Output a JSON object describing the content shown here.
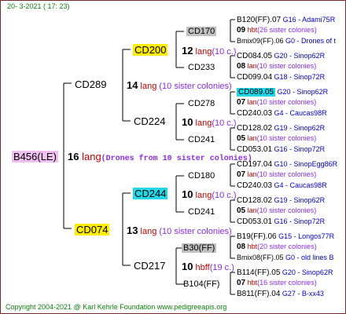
{
  "date": "20-  3-2021 ( 17: 23)",
  "footer": "Copyright 2004-2021 @ Karl Kehrle Foundation    www.pedigreeapis.org",
  "colors": {
    "yellow": "#ffee00",
    "cyan": "#22d8e8",
    "pink": "#f0c0f0",
    "gray": "#c0c0c0",
    "brand_green": "#0a7d0a",
    "lang_red": "#c00000",
    "annotation_purple": "#8a2be2",
    "info_blue": "#0000c0"
  },
  "root": {
    "name": "B456(LE)",
    "num": "16",
    "lang": "lang",
    "note": "(Drones from 10 sister colonies)"
  },
  "gen1": [
    {
      "name": "CD289",
      "num": "14",
      "lang": "lang",
      "note": "(10 sister colonies)"
    },
    {
      "name": "CD074",
      "num": "13",
      "lang": "lang",
      "note": "(10 sister colonies)"
    }
  ],
  "gen2": [
    {
      "name": "CD200",
      "num": "12",
      "lang": "lang",
      "note": "(10 c.)"
    },
    {
      "name": "CD224",
      "num": "10",
      "lang": "lang",
      "note": "(10 c.)"
    },
    {
      "name": "CD244",
      "num": "10",
      "lang": "lang",
      "note": "(10 c.)"
    },
    {
      "name": "CD217",
      "num": "10",
      "lang": "hbff",
      "note": "(19 c.)"
    }
  ],
  "gen3": [
    {
      "name": "CD170"
    },
    {
      "name": "CD233"
    },
    {
      "name": "CD278"
    },
    {
      "name": "CD241"
    },
    {
      "name": "CD180"
    },
    {
      "name": "CD241"
    },
    {
      "name": "B30(FF)"
    },
    {
      "name": "B104(FF)"
    }
  ],
  "gen4": [
    {
      "top": "B120(FF).07",
      "top_info": "G16 - Adami75R",
      "num": "09",
      "lang": "hbt",
      "note": "(26 sister colonies)",
      "bottom": "Bmix09(FF).06",
      "bottom_info": "G0 - Drones of t"
    },
    {
      "top": "CD084.05",
      "top_info": "G20 - Sinop62R",
      "num": "08",
      "lang": "lan",
      "note": "(10 sister colonies)",
      "bottom": "CD099.04",
      "bottom_info": "G18 - Sinop72R"
    },
    {
      "top": "CD089.05",
      "top_info": "G20 - Sinop62R",
      "num": "07",
      "lang": "lan",
      "note": "(10 sister colonies)",
      "bottom": "CD240.03",
      "bottom_info": "G4 - Caucas98R"
    },
    {
      "top": "CD128.02",
      "top_info": "G19 - Sinop62R",
      "num": "05",
      "lang": "lan",
      "note": "(10 sister colonies)",
      "bottom": "CD053.01",
      "bottom_info": "G16 - Sinop72R"
    },
    {
      "top": "CD197.04",
      "top_info": "G10 - SinopEgg86R",
      "num": "07",
      "lang": "lan",
      "note": "(10 sister colonies)",
      "bottom": "CD240.03",
      "bottom_info": "G4 - Caucas98R"
    },
    {
      "top": "CD128.02",
      "top_info": "G19 - Sinop62R",
      "num": "05",
      "lang": "lan",
      "note": "(10 sister colonies)",
      "bottom": "CD053.01",
      "bottom_info": "G16 - Sinop72R"
    },
    {
      "top": "B19(FF).06",
      "top_info": "G15 - Longos77R",
      "num": "08",
      "lang": "hbt",
      "note": "(20 sister colonies)",
      "bottom": "Bmix08(FF).05",
      "bottom_info": "G0 - old lines B"
    },
    {
      "top": "B114(FF).05",
      "top_info": "G20 - Sinop62R",
      "num": "07",
      "lang": "hbt",
      "note": "(16 sister colonies)",
      "bottom": "B811(FF).04",
      "bottom_info": "G27 - B-xx43"
    }
  ]
}
